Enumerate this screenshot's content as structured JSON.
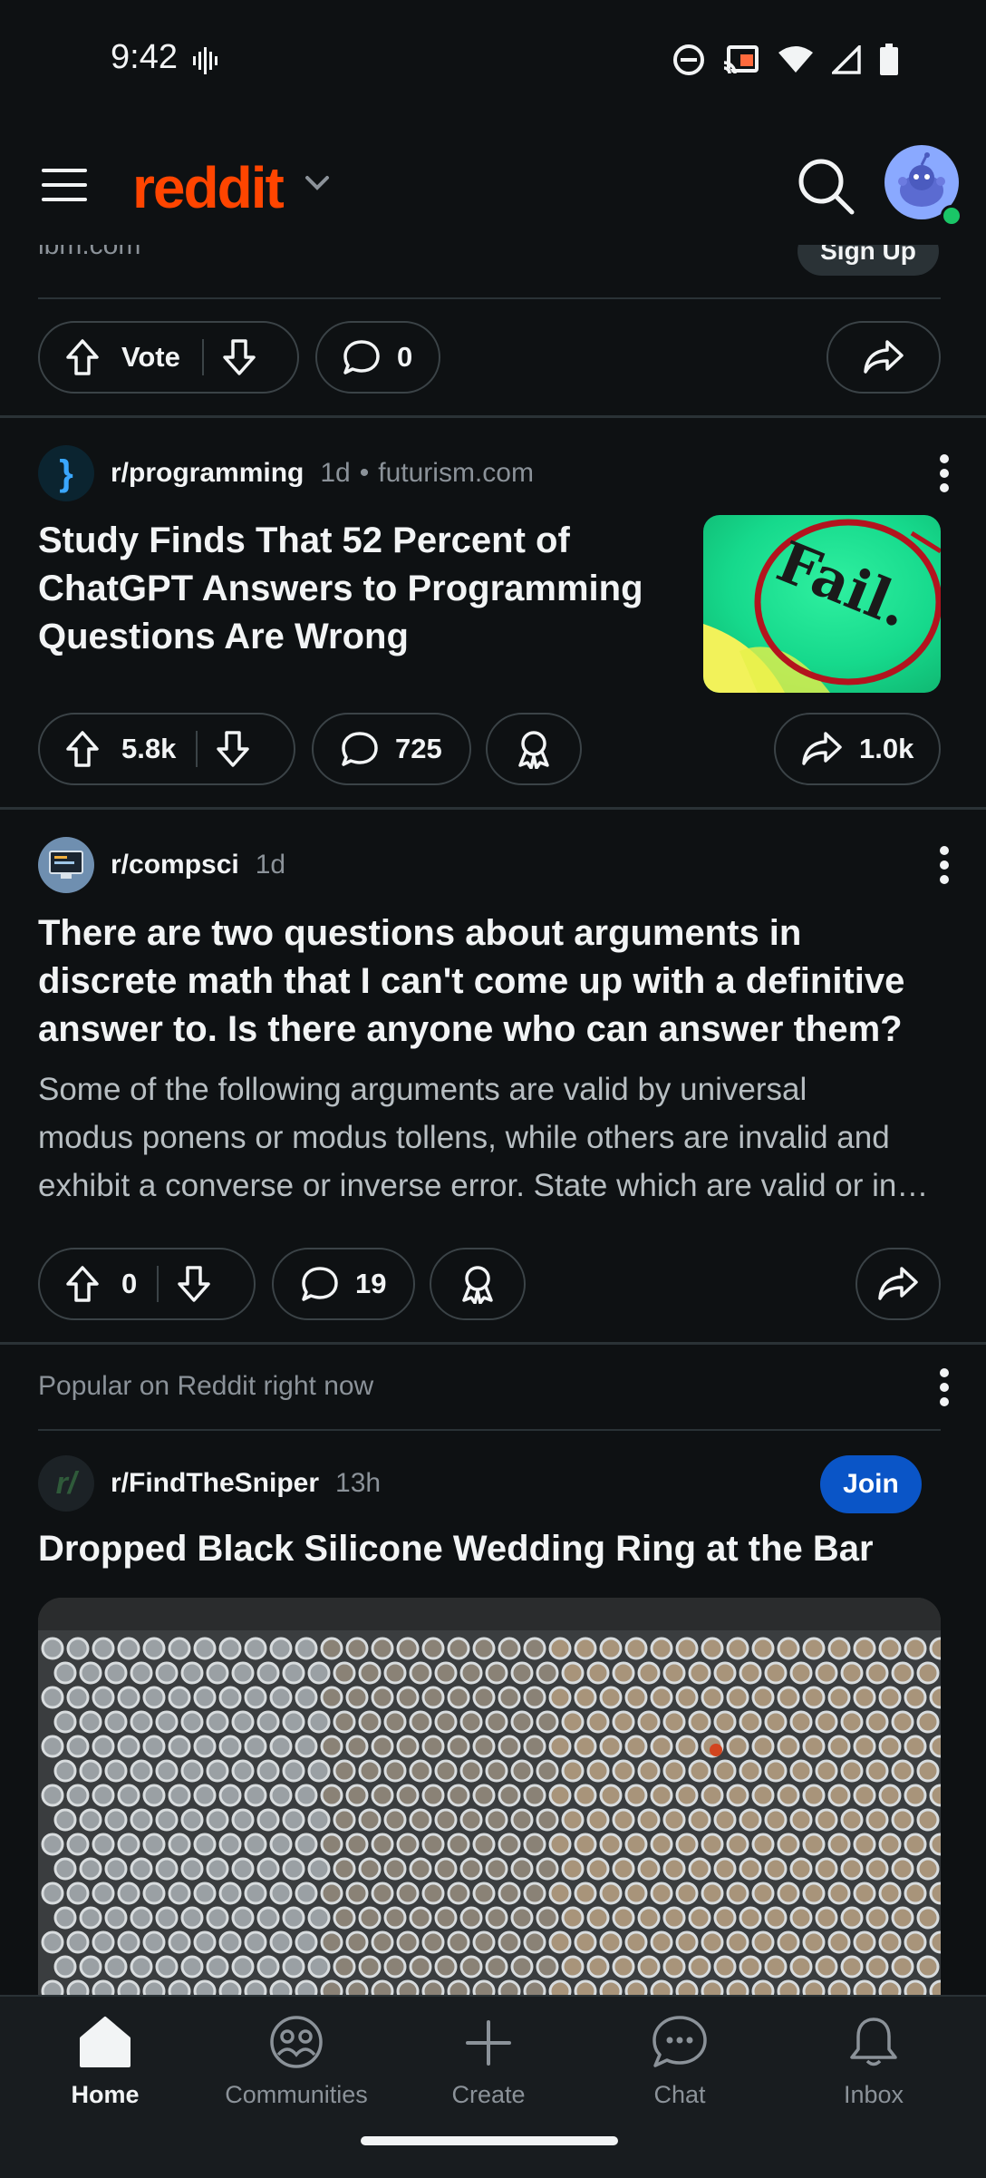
{
  "status_bar": {
    "time": "9:42"
  },
  "header": {
    "logo": "reddit"
  },
  "ad_partial": {
    "domain": "ibm.com",
    "signup_label": "Sign Up",
    "vote_label": "Vote",
    "comments": "0"
  },
  "posts": [
    {
      "subreddit": "r/programming",
      "age": "1d",
      "source": "futurism.com",
      "title_lines": [
        "Study Finds That 52 Percent of",
        "ChatGPT Answers to Programming",
        "Questions Are Wrong"
      ],
      "thumbnail_text": "Fail.",
      "votes": "5.8k",
      "comments": "725",
      "shares": "1.0k"
    },
    {
      "subreddit": "r/compsci",
      "age": "1d",
      "title_lines": [
        "There are two questions about arguments in",
        "discrete math that I can't come up with a definitive",
        "answer to. Is there anyone who can answer them?"
      ],
      "body_lines": [
        "Some of the following arguments are valid by universal",
        "modus ponens or modus tollens, while others are invalid and",
        "exhibit a converse or inverse error. State which are valid or in…"
      ],
      "votes": "0",
      "comments": "19"
    }
  ],
  "popular": {
    "heading": "Popular on Reddit right now",
    "subreddit": "r/FindTheSniper",
    "sub_icon_text": "r/",
    "age": "13h",
    "join_label": "Join",
    "title": "Dropped Black Silicone Wedding Ring at the Bar"
  },
  "bottom_nav": {
    "items": [
      {
        "label": "Home",
        "icon": "home-icon"
      },
      {
        "label": "Communities",
        "icon": "communities-icon"
      },
      {
        "label": "Create",
        "icon": "plus-icon"
      },
      {
        "label": "Chat",
        "icon": "chat-icon"
      },
      {
        "label": "Inbox",
        "icon": "bell-icon"
      }
    ]
  },
  "colors": {
    "brand": "#ff4500",
    "background": "#0e1113",
    "join": "#0a55c7",
    "online": "#1ac667"
  }
}
